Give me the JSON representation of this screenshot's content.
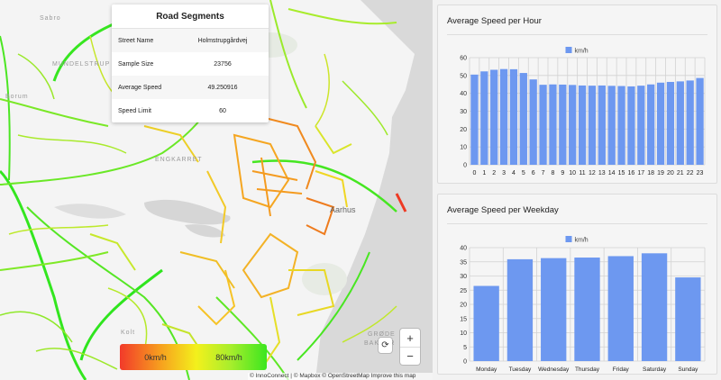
{
  "map": {
    "place_labels": [
      {
        "text": "Sabro"
      },
      {
        "text": "MUNDELSTRUP"
      },
      {
        "text": "Borum"
      },
      {
        "text": "ENGKARRET"
      },
      {
        "text": "Aarhus"
      },
      {
        "text": "GRØDE"
      },
      {
        "text": "BAKKER"
      },
      {
        "text": "Kolt"
      }
    ],
    "segment_info": {
      "title": "Road Segments",
      "rows": [
        {
          "label": "Street Name",
          "value": "Holmstrupgårdvej"
        },
        {
          "label": "Sample Size",
          "value": "23756"
        },
        {
          "label": "Average Speed",
          "value": "49.250916"
        },
        {
          "label": "Speed Limit",
          "value": "60"
        }
      ]
    },
    "legend": {
      "min_label": "0km/h",
      "max_label": "80km/h"
    },
    "controls": {
      "zoom_in": "+",
      "zoom_out": "−",
      "reset_icon": "compass-reset-icon"
    },
    "attribution": "© InnoConnect | © Mapbox © OpenStreetMap  Improve this map"
  },
  "colors": {
    "bar": "#6d98f0",
    "slow": "#f23a2a",
    "mid": "#f3f01c",
    "fast": "#3ce61f"
  },
  "panels": {
    "hour_title": "Average Speed per Hour",
    "weekday_title": "Average Speed per Weekday"
  },
  "chart_data": [
    {
      "type": "bar",
      "title": "Average Speed per Hour",
      "legend": "km/h",
      "legend_position": "top",
      "categories": [
        "0",
        "1",
        "2",
        "3",
        "4",
        "5",
        "6",
        "7",
        "8",
        "9",
        "10",
        "11",
        "12",
        "13",
        "14",
        "15",
        "16",
        "17",
        "18",
        "19",
        "20",
        "21",
        "22",
        "23"
      ],
      "series": [
        {
          "name": "km/h",
          "values": [
            50.5,
            52.3,
            53.2,
            53.6,
            53.5,
            51.4,
            47.8,
            44.8,
            45.0,
            44.9,
            44.7,
            44.4,
            44.3,
            44.4,
            44.2,
            44.1,
            43.9,
            44.3,
            45.0,
            46.0,
            46.4,
            46.7,
            47.2,
            48.6
          ]
        }
      ],
      "ylim": [
        0,
        60
      ],
      "yticks": [
        0,
        10,
        20,
        30,
        40,
        50,
        60
      ],
      "grid": true
    },
    {
      "type": "bar",
      "title": "Average Speed per Weekday",
      "legend": "km/h",
      "legend_position": "top",
      "categories": [
        "Monday",
        "Tuesday",
        "Wednesday",
        "Thursday",
        "Friday",
        "Saturday",
        "Sunday"
      ],
      "series": [
        {
          "name": "km/h",
          "values": [
            26.5,
            35.9,
            36.3,
            36.5,
            37.0,
            38.0,
            29.5
          ]
        }
      ],
      "ylim": [
        0,
        40
      ],
      "yticks": [
        0,
        5,
        10,
        15,
        20,
        25,
        30,
        35,
        40
      ],
      "grid": true
    }
  ]
}
